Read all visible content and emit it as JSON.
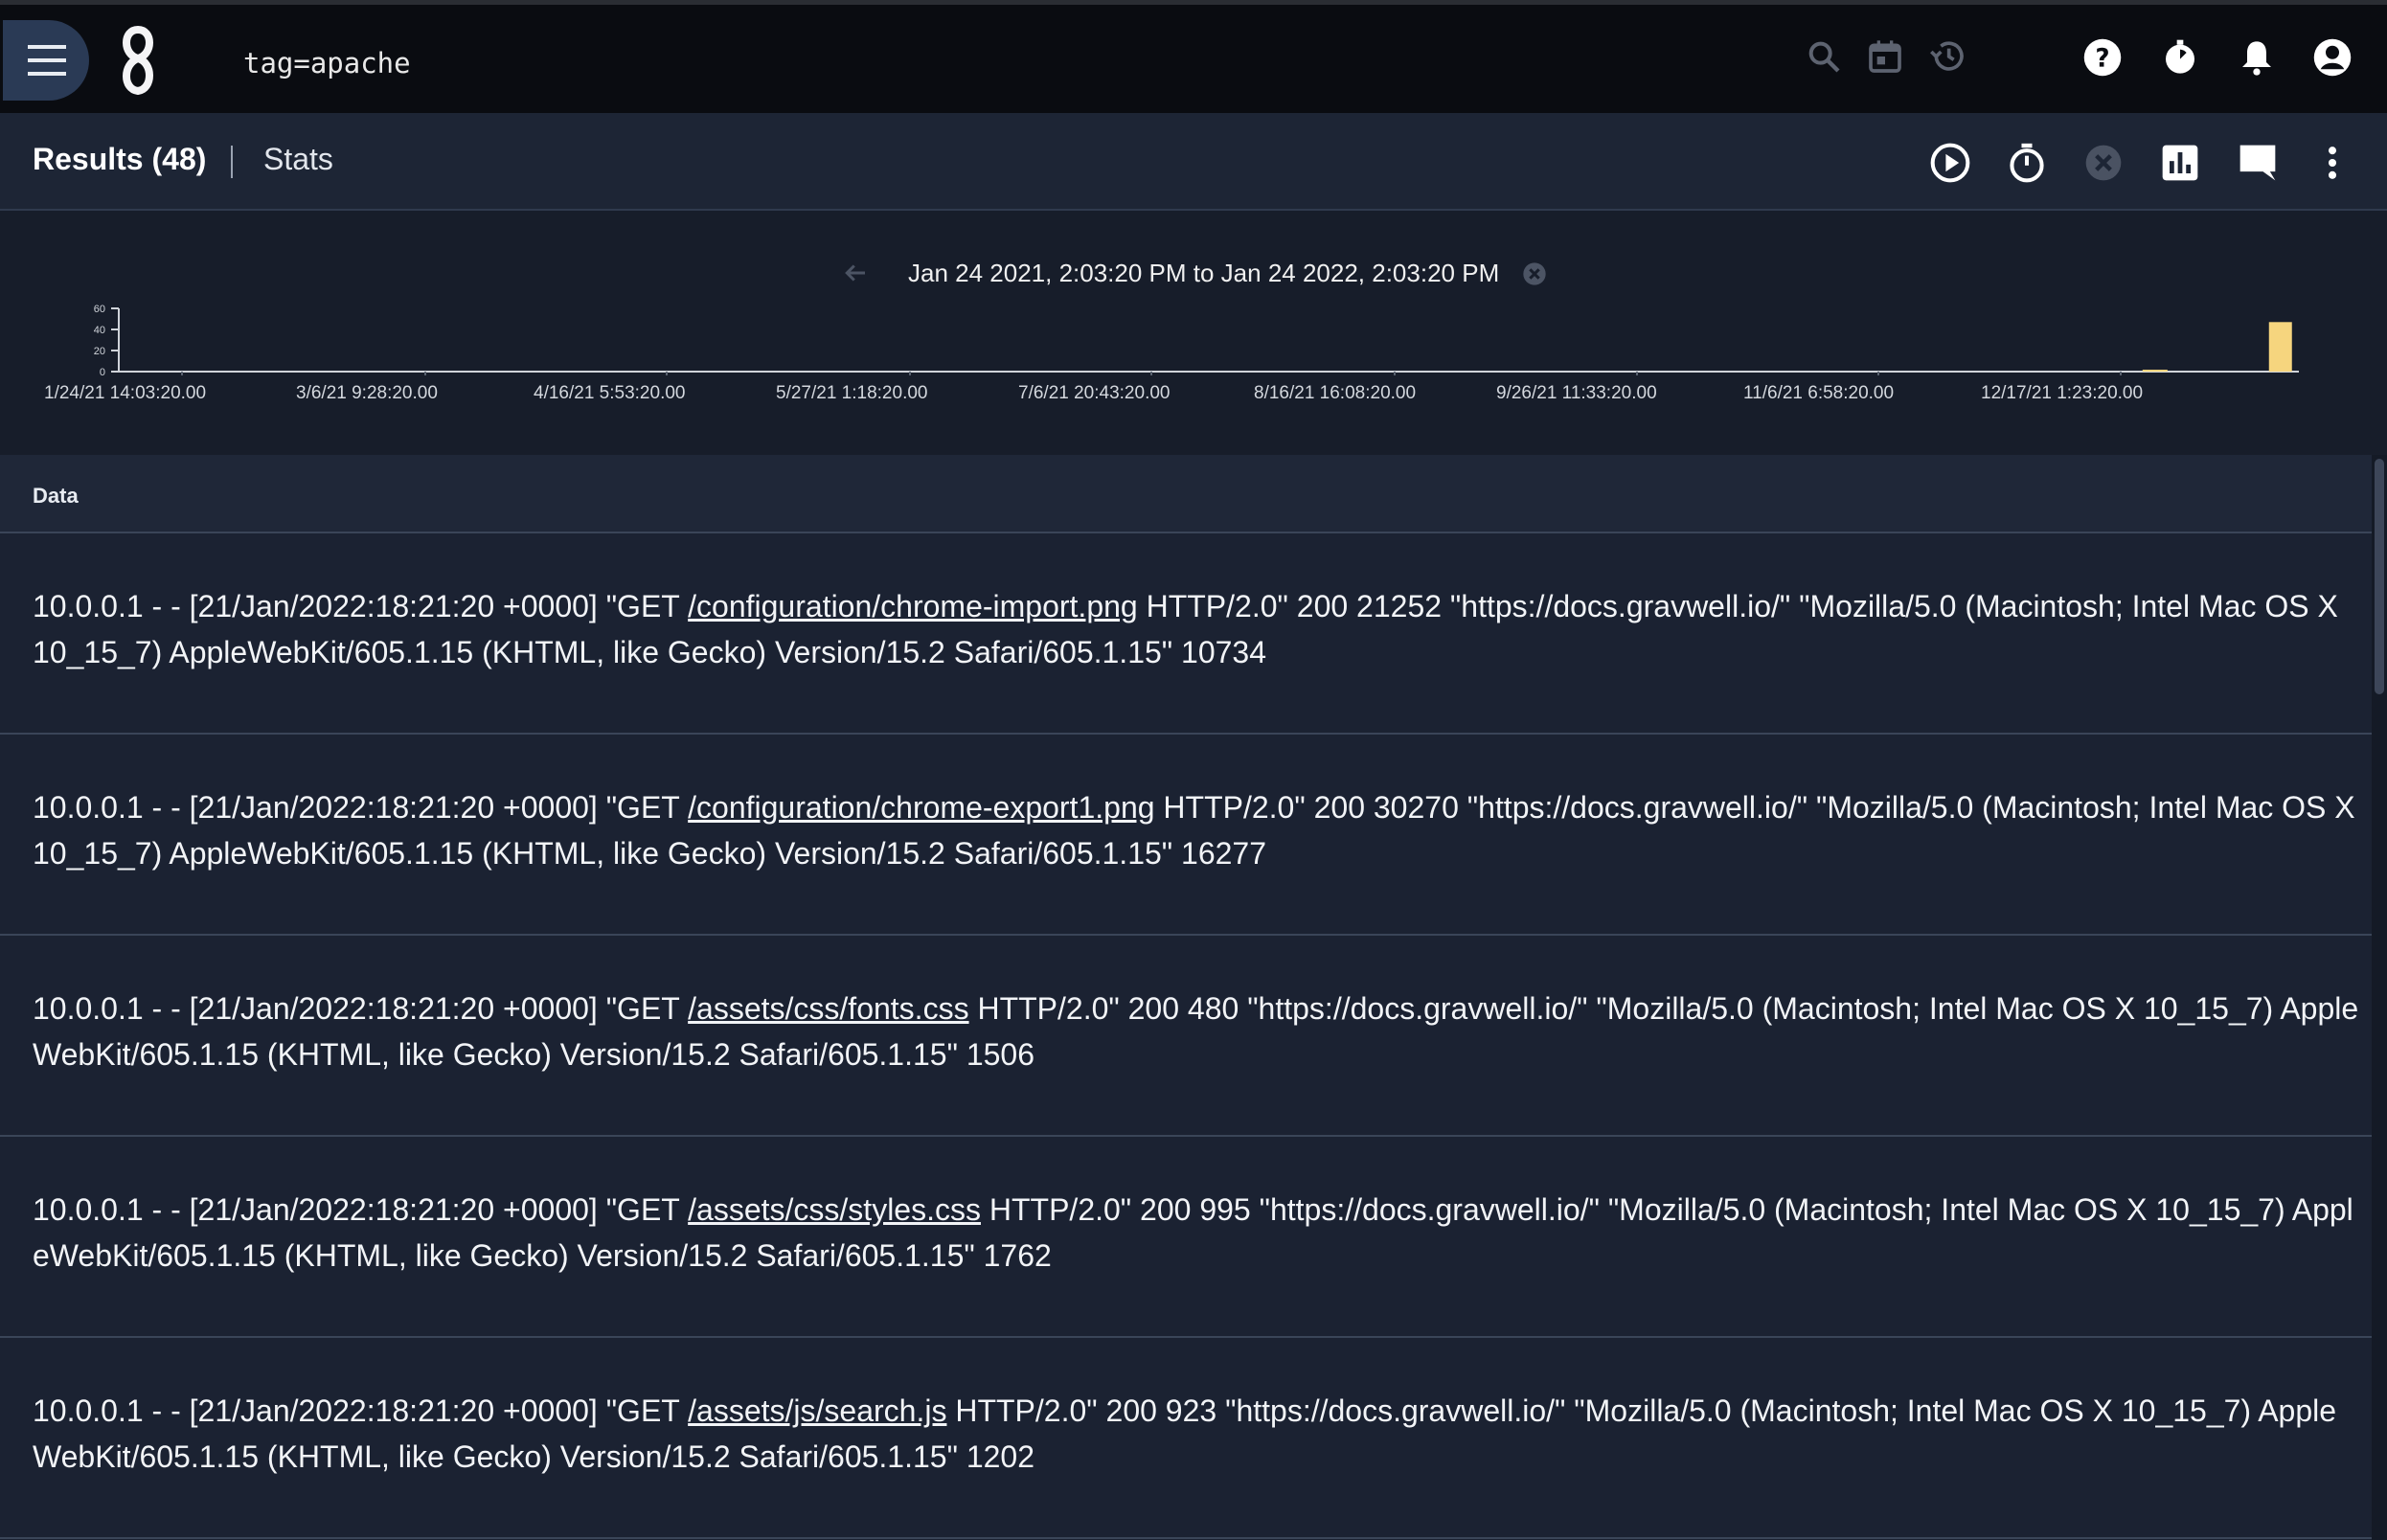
{
  "header": {
    "query": "tag=apache",
    "icons": [
      "menu-icon",
      "gravwell-logo",
      "search-icon",
      "calendar-icon",
      "history-icon",
      "help-icon",
      "timer-icon",
      "bell-icon",
      "account-icon"
    ]
  },
  "toolbar": {
    "results_label": "Results (48)",
    "stats_label": "Stats",
    "icons": [
      "play-icon",
      "stopwatch-icon",
      "cancel-icon",
      "chart-icon",
      "comment-icon",
      "more-vert-icon"
    ]
  },
  "histogram": {
    "range_text": "Jan 24 2021, 2:03:20 PM to Jan 24 2022, 2:03:20 PM",
    "accent": "#f6d57e"
  },
  "chart_data": {
    "type": "bar",
    "ylim": [
      0,
      60
    ],
    "y_ticks": [
      "60",
      "40",
      "20",
      "0"
    ],
    "x_tick_labels": [
      "1/24/21 14:03:20.00",
      "3/6/21 9:28:20.00",
      "4/16/21 5:53:20.00",
      "5/27/21 1:18:20.00",
      "7/6/21 20:43:20.00",
      "8/16/21 16:08:20.00",
      "9/26/21 11:33:20.00",
      "11/6/21 6:58:20.00",
      "12/17/21 1:23:20.00"
    ],
    "series": [
      {
        "values": [
          {
            "x": "2021-12-31",
            "y": 1
          },
          {
            "x": "2022-01-21",
            "y": 47
          }
        ]
      }
    ]
  },
  "table": {
    "column": "Data",
    "rows": [
      {
        "pre": "10.0.0.1 - - [21/Jan/2022:18:21:20 +0000] \"GET ",
        "link": "/configuration/chrome-import.png",
        "post": " HTTP/2.0\" 200 21252 \"https://docs.gravwell.io/\" \"Mozilla/5.0 (Macintosh; Intel Mac OS X 10_15_7) AppleWebKit/605.1.15 (KHTML, like Gecko) Version/15.2 Safari/605.1.15\" 10734"
      },
      {
        "pre": "10.0.0.1 - - [21/Jan/2022:18:21:20 +0000] \"GET ",
        "link": "/configuration/chrome-export1.png",
        "post": " HTTP/2.0\" 200 30270 \"https://docs.gravwell.io/\" \"Mozilla/5.0 (Macintosh; Intel Mac OS X 10_15_7) AppleWebKit/605.1.15 (KHTML, like Gecko) Version/15.2 Safari/605.1.15\" 16277"
      },
      {
        "pre": "10.0.0.1 - - [21/Jan/2022:18:21:20 +0000] \"GET ",
        "link": "/assets/css/fonts.css",
        "post": " HTTP/2.0\" 200 480 \"https://docs.gravwell.io/\" \"Mozilla/5.0 (Macintosh; Intel Mac OS X 10_15_7) AppleWebKit/605.1.15 (KHTML, like Gecko) Version/15.2 Safari/605.1.15\" 1506"
      },
      {
        "pre": "10.0.0.1 - - [21/Jan/2022:18:21:20 +0000] \"GET ",
        "link": "/assets/css/styles.css",
        "post": " HTTP/2.0\" 200 995 \"https://docs.gravwell.io/\" \"Mozilla/5.0 (Macintosh; Intel Mac OS X 10_15_7) AppleWebKit/605.1.15 (KHTML, like Gecko) Version/15.2 Safari/605.1.15\" 1762"
      },
      {
        "pre": "10.0.0.1 - - [21/Jan/2022:18:21:20 +0000] \"GET ",
        "link": "/assets/js/search.js",
        "post": " HTTP/2.0\" 200 923 \"https://docs.gravwell.io/\" \"Mozilla/5.0 (Macintosh; Intel Mac OS X 10_15_7) AppleWebKit/605.1.15 (KHTML, like Gecko) Version/15.2 Safari/605.1.15\" 1202"
      }
    ]
  }
}
